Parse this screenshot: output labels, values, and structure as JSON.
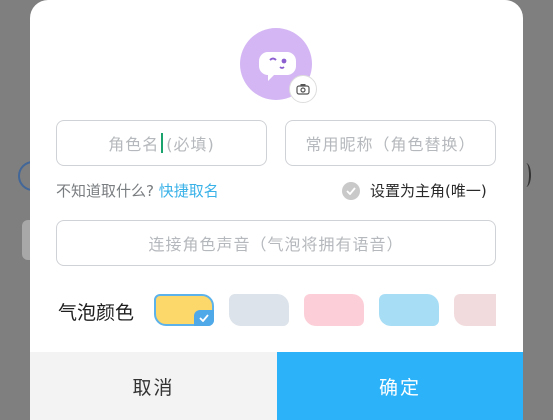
{
  "dialog": {
    "name_placeholder_main": "角色名",
    "name_placeholder_req": "(必填)",
    "nick_placeholder": "常用昵称（角色替换）",
    "hint_text": "不知道取什么?",
    "hint_link": "快捷取名",
    "main_role_label": "设置为主角(唯一)",
    "voice_placeholder": "连接角色声音（气泡将拥有语音）",
    "bubble_color_label": "气泡颜色",
    "bubble_colors": [
      "#fcd76a",
      "#dde3ea",
      "#fccfd8",
      "#a8ddf6",
      "#f2dbdd"
    ],
    "selected_color_index": 0,
    "cancel_label": "取消",
    "ok_label": "确定"
  },
  "colors": {
    "accent": "#2cb2f8",
    "link": "#3ab2e8",
    "avatar_bg": "#d3b6f3"
  },
  "icons": {
    "avatar": "chat-bubble-face-icon",
    "camera": "camera-icon",
    "main_role_check": "check-circle-icon",
    "selected_swatch": "check-icon"
  }
}
